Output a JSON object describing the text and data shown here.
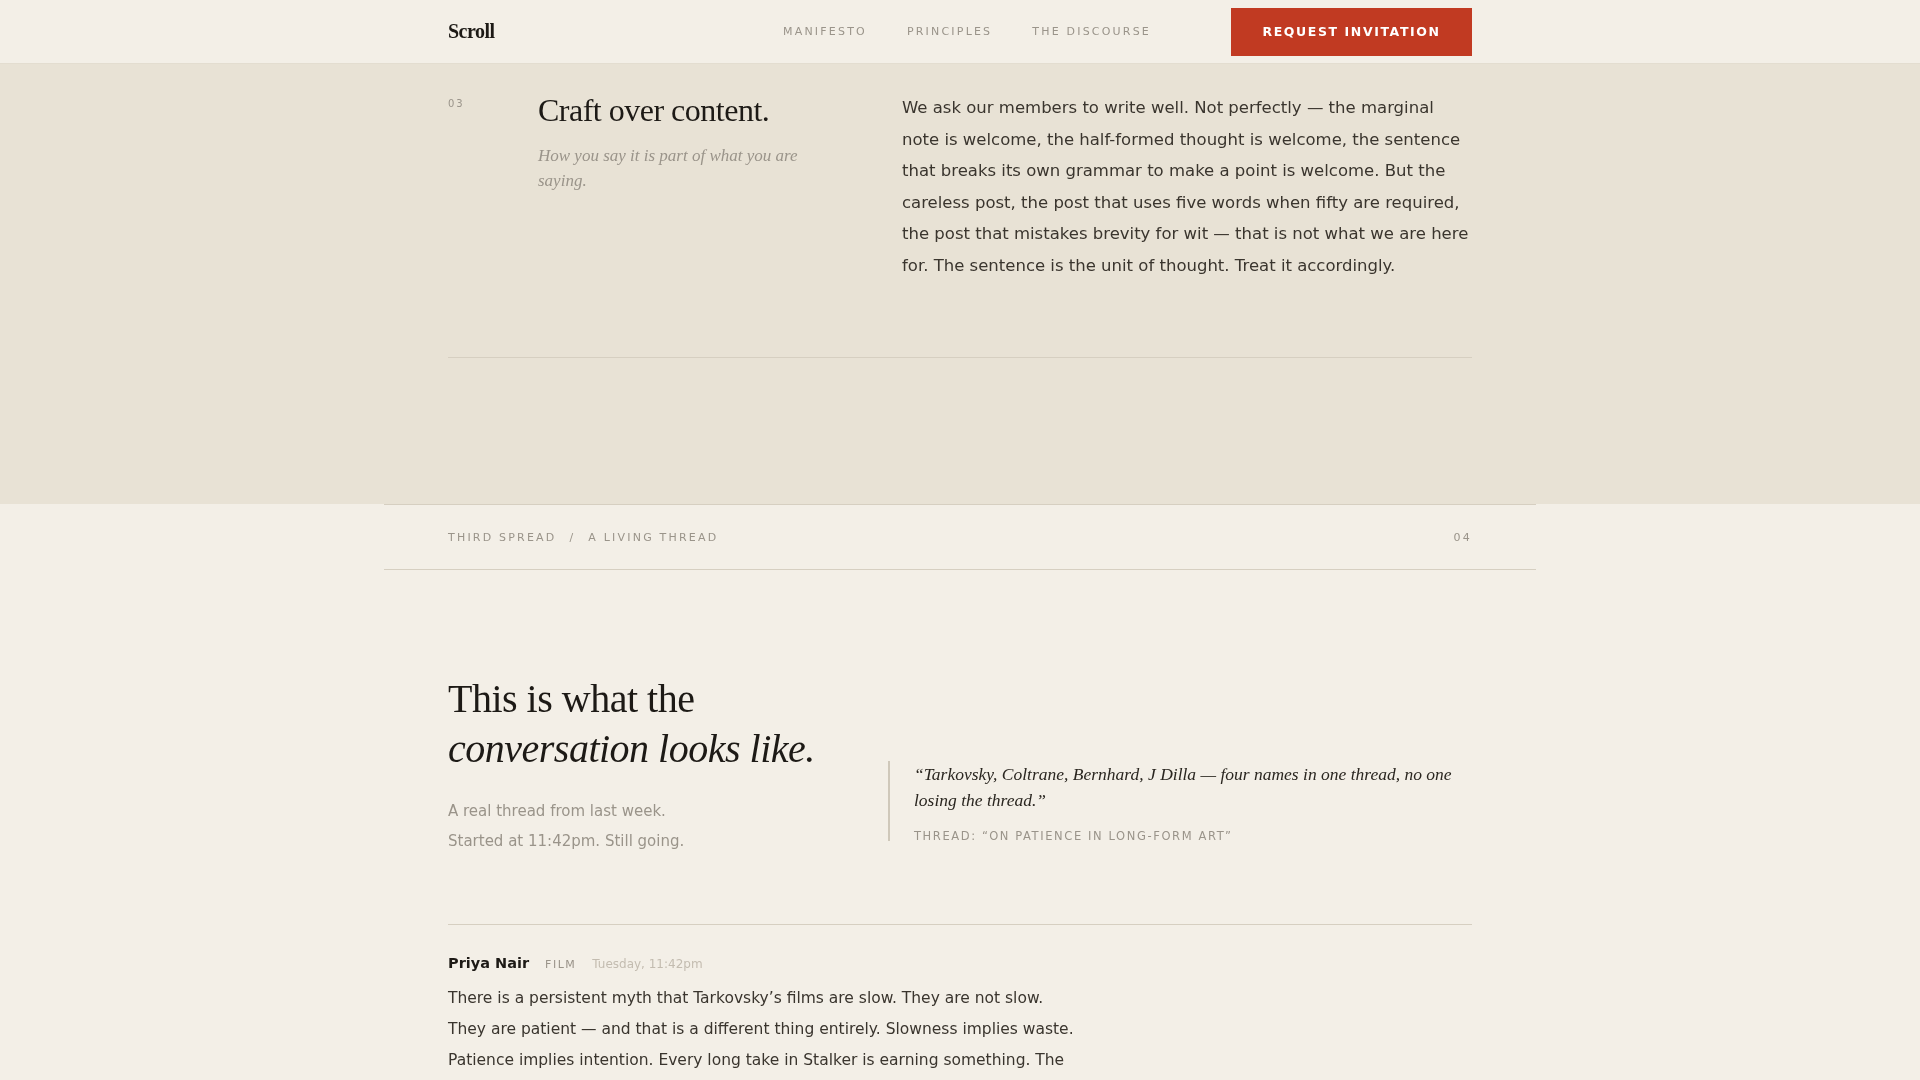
{
  "header": {
    "logo": "Scroll",
    "nav": [
      {
        "label": "MANIFESTO"
      },
      {
        "label": "PRINCIPLES"
      },
      {
        "label": "THE DISCOURSE"
      }
    ],
    "cta": "REQUEST INVITATION"
  },
  "principle": {
    "number": "03",
    "title": "Craft over content.",
    "subtitle": "How you say it is part of what you are saying.",
    "body": "We ask our members to write well. Not perfectly — the marginal note is welcome, the half-formed thought is welcome, the sentence that breaks its own grammar to make a point is welcome. But the careless post, the post that uses five words when fifty are required, the post that mistakes brevity for wit — that is not what we are here for. The sentence is the unit of thought. Treat it accordingly."
  },
  "spread_bar": {
    "label": "THIRD SPREAD",
    "separator": "/",
    "title": "A LIVING THREAD",
    "number": "04"
  },
  "thread_intro": {
    "heading_line_1": "This is what the",
    "heading_line_2": "conversation looks like.",
    "lines": [
      "A real thread from last week.",
      "Started at 11:42pm. Still going."
    ],
    "quote": "“Tarkovsky, Coltrane, Bernhard, J Dilla — four names in one thread, no one losing the thread.”",
    "quote_source": "THREAD: “ON PATIENCE IN LONG-FORM ART”"
  },
  "posts": [
    {
      "author": "Priya Nair",
      "tag": "FILM",
      "time": "Tuesday, 11:42pm",
      "lines": [
        "There is a persistent myth that Tarkovsky’s films are slow. They are not slow.",
        "They are patient — and that is a different thing entirely. Slowness implies waste.",
        "Patience implies intention. Every long take in Stalker is earning something. The"
      ]
    }
  ]
}
